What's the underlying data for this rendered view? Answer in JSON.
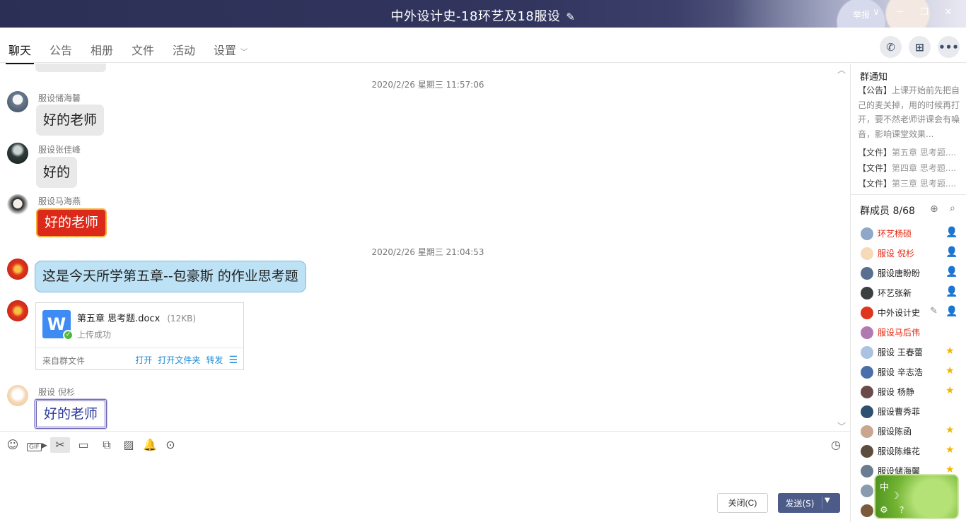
{
  "window": {
    "title": "中外设计史-18环艺及18服设",
    "report": "举报"
  },
  "tabs": [
    {
      "label": "聊天"
    },
    {
      "label": "公告"
    },
    {
      "label": "相册"
    },
    {
      "label": "文件"
    },
    {
      "label": "活动"
    },
    {
      "label": "设置"
    }
  ],
  "chat": {
    "timestamps": [
      "2020/2/26 星期三 11:57:06",
      "2020/2/26 星期三 21:04:53"
    ],
    "messages": [
      {
        "sender": "服设储海馨",
        "text": "好的老师"
      },
      {
        "sender": "服设张佳峰",
        "text": "好的"
      },
      {
        "sender": "服设马海燕",
        "text": "好的老师"
      },
      {
        "sender": "",
        "text": "这是今天所学第五章--包豪斯   的作业思考题"
      },
      {
        "sender": "服设  倪杉",
        "text": "好的老师"
      }
    ],
    "file": {
      "name": "第五章   思考题.docx",
      "size": "(12KB)",
      "status": "上传成功",
      "source": "来自群文件",
      "actions": [
        "打开",
        "打开文件夹",
        "转发"
      ]
    }
  },
  "input": {
    "close_label": "关闭(C)",
    "send_label": "发送(S)"
  },
  "panel": {
    "notice_title": "群通知",
    "notice_tag": "【公告】",
    "notice_text": "上课开始前先把自己的麦关掉，用的时候再打开，要不然老师讲课会有噪音，影响课堂效果...",
    "files": [
      {
        "tag": "【文件】",
        "text": "第五章    思考题...."
      },
      {
        "tag": "【文件】",
        "text": "第四章    思考题...."
      },
      {
        "tag": "【文件】",
        "text": "第三章    思考题...."
      }
    ],
    "members_title": "群成员 8/68",
    "members": [
      {
        "name": "环艺杨硕",
        "red": true,
        "badge": "person"
      },
      {
        "name": "服设  倪杉",
        "red": true,
        "badge": "person"
      },
      {
        "name": "服设唐盼盼",
        "red": false,
        "badge": "person"
      },
      {
        "name": "环艺张新",
        "red": false,
        "badge": "person"
      },
      {
        "name": "中外设计史",
        "red": false,
        "badge": "person"
      },
      {
        "name": "服设马后伟",
        "red": true,
        "badge": ""
      },
      {
        "name": "服设 王春蕾",
        "red": false,
        "badge": "star"
      },
      {
        "name": "服设 辛志浩",
        "red": false,
        "badge": "star"
      },
      {
        "name": "服设 杨静",
        "red": false,
        "badge": "star"
      },
      {
        "name": "服设曹秀菲",
        "red": false,
        "badge": ""
      },
      {
        "name": "服设陈函",
        "red": false,
        "badge": "star"
      },
      {
        "name": "服设陈维花",
        "red": false,
        "badge": "star"
      },
      {
        "name": "服设储海馨",
        "red": false,
        "badge": "star"
      },
      {
        "name": "",
        "red": false,
        "badge": ""
      },
      {
        "name": "",
        "red": false,
        "badge": ""
      }
    ]
  },
  "ime": {
    "label": "中"
  }
}
